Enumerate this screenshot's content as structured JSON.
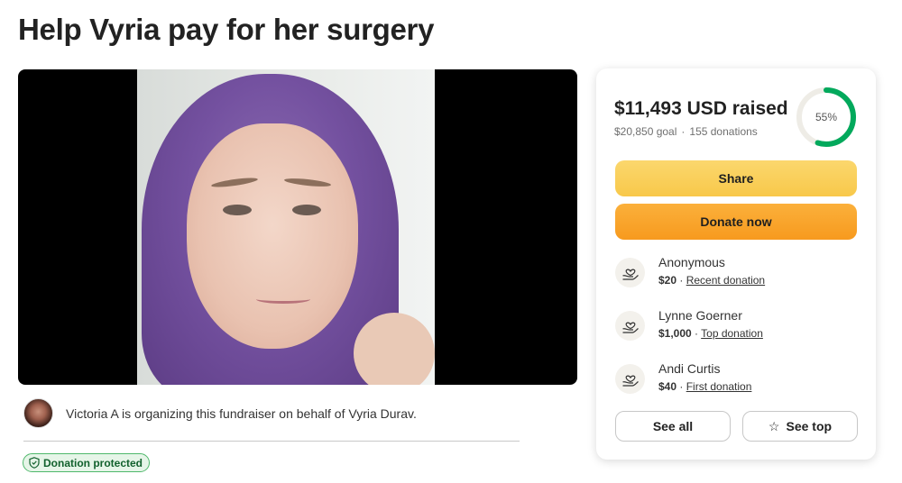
{
  "page": {
    "title": "Help Vyria pay for her surgery"
  },
  "organizer": {
    "text": "Victoria A is organizing this fundraiser on behalf of Vyria Durav."
  },
  "badge": {
    "label": "Donation protected"
  },
  "donation_card": {
    "raised": "$11,493 USD raised",
    "goal": "$20,850 goal",
    "donations": "155 donations",
    "progress_label": "55%",
    "progress_fraction": 0.55,
    "share_label": "Share",
    "donate_label": "Donate now",
    "donors": [
      {
        "name": "Anonymous",
        "amount": "$20",
        "tag": "Recent donation"
      },
      {
        "name": "Lynne Goerner",
        "amount": "$1,000",
        "tag": "Top donation"
      },
      {
        "name": "Andi Curtis",
        "amount": "$40",
        "tag": "First donation"
      }
    ],
    "see_all_label": "See all",
    "see_top_label": "See top"
  },
  "colors": {
    "progress": "#02a95c",
    "share_button": "#f8c84a",
    "donate_button": "#f79a1e",
    "badge_border": "#4fb86b"
  }
}
